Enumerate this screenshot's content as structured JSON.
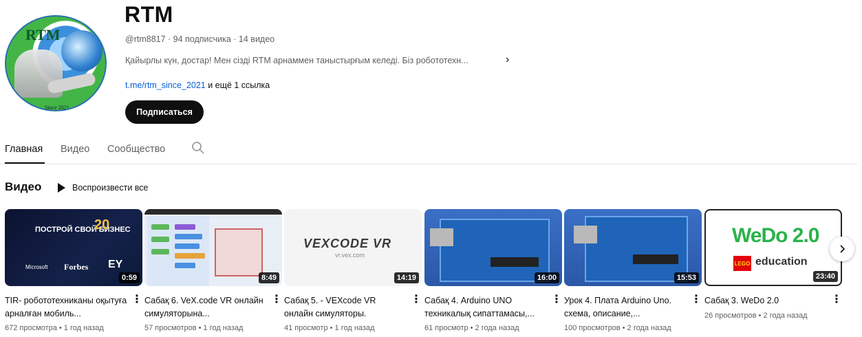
{
  "channel": {
    "name": "RTM",
    "meta": "@rtm8817 · 94 подписчика · 14 видео",
    "description": "Қайырлы күн, достар! Мен сізді RTM арнаммен таныстырғым келеді. Біз робототехн...",
    "desc_arrow": "›",
    "link": "t.me/rtm_since_2021",
    "more_links": " и ещё 1 ссылка",
    "subscribe_label": "Подписаться",
    "avatar_logo": "RTM",
    "avatar_since": "Since 2021"
  },
  "tabs": [
    {
      "label": "Главная",
      "active": true
    },
    {
      "label": "Видео",
      "active": false
    },
    {
      "label": "Сообщество",
      "active": false
    }
  ],
  "section": {
    "title": "Видео",
    "play_all": "Воспроизвести все"
  },
  "videos": [
    {
      "title": "TIR- робототехниканы оқытуға арналған мобиль...",
      "views": "672 просмотра",
      "age": "1 год назад",
      "duration": "0:59",
      "thumb_text": {
        "a": "ПОСТРОЙ СВОЙ БИЗНЕС",
        "c": "20",
        "d": "Microsoft",
        "e": "Forbes",
        "f": "EY"
      }
    },
    {
      "title": "Сабақ 6. VeX.code VR онлайн симуляторына...",
      "views": "57 просмотров",
      "age": "1 год назад",
      "duration": "8:49"
    },
    {
      "title": "Сабақ 5. - VEXcode VR онлайн симуляторы.",
      "views": "41 просмотр",
      "age": "1 год назад",
      "duration": "14:19",
      "thumb_text": {
        "logo": "VEXCODE VR",
        "url": "vr.vex.com"
      }
    },
    {
      "title": "Сабақ 4. Arduino UNO техникалық сипаттамасы,...",
      "views": "61 просмотр",
      "age": "2 года назад",
      "duration": "16:00"
    },
    {
      "title": "Урок 4. Плата Arduino Uno. схема, описание,...",
      "views": "100 просмотров",
      "age": "2 года назад",
      "duration": "15:53"
    },
    {
      "title": "Сабақ 3. WeDo 2.0",
      "views": "26 просмотров",
      "age": "2 года назад",
      "duration": "23:40",
      "thumb_text": {
        "w": "WeDo 2.0",
        "lego": "LEGO",
        "edu": "education"
      }
    }
  ],
  "meta_sep": " • ",
  "icons": {
    "search": "search-icon",
    "play": "play-icon",
    "kebab": "⋮",
    "next": "chevron-right-icon"
  },
  "colors": {
    "link": "#065fd4",
    "subscribe_bg": "#0f0f0f",
    "secondary_text": "#606060"
  }
}
